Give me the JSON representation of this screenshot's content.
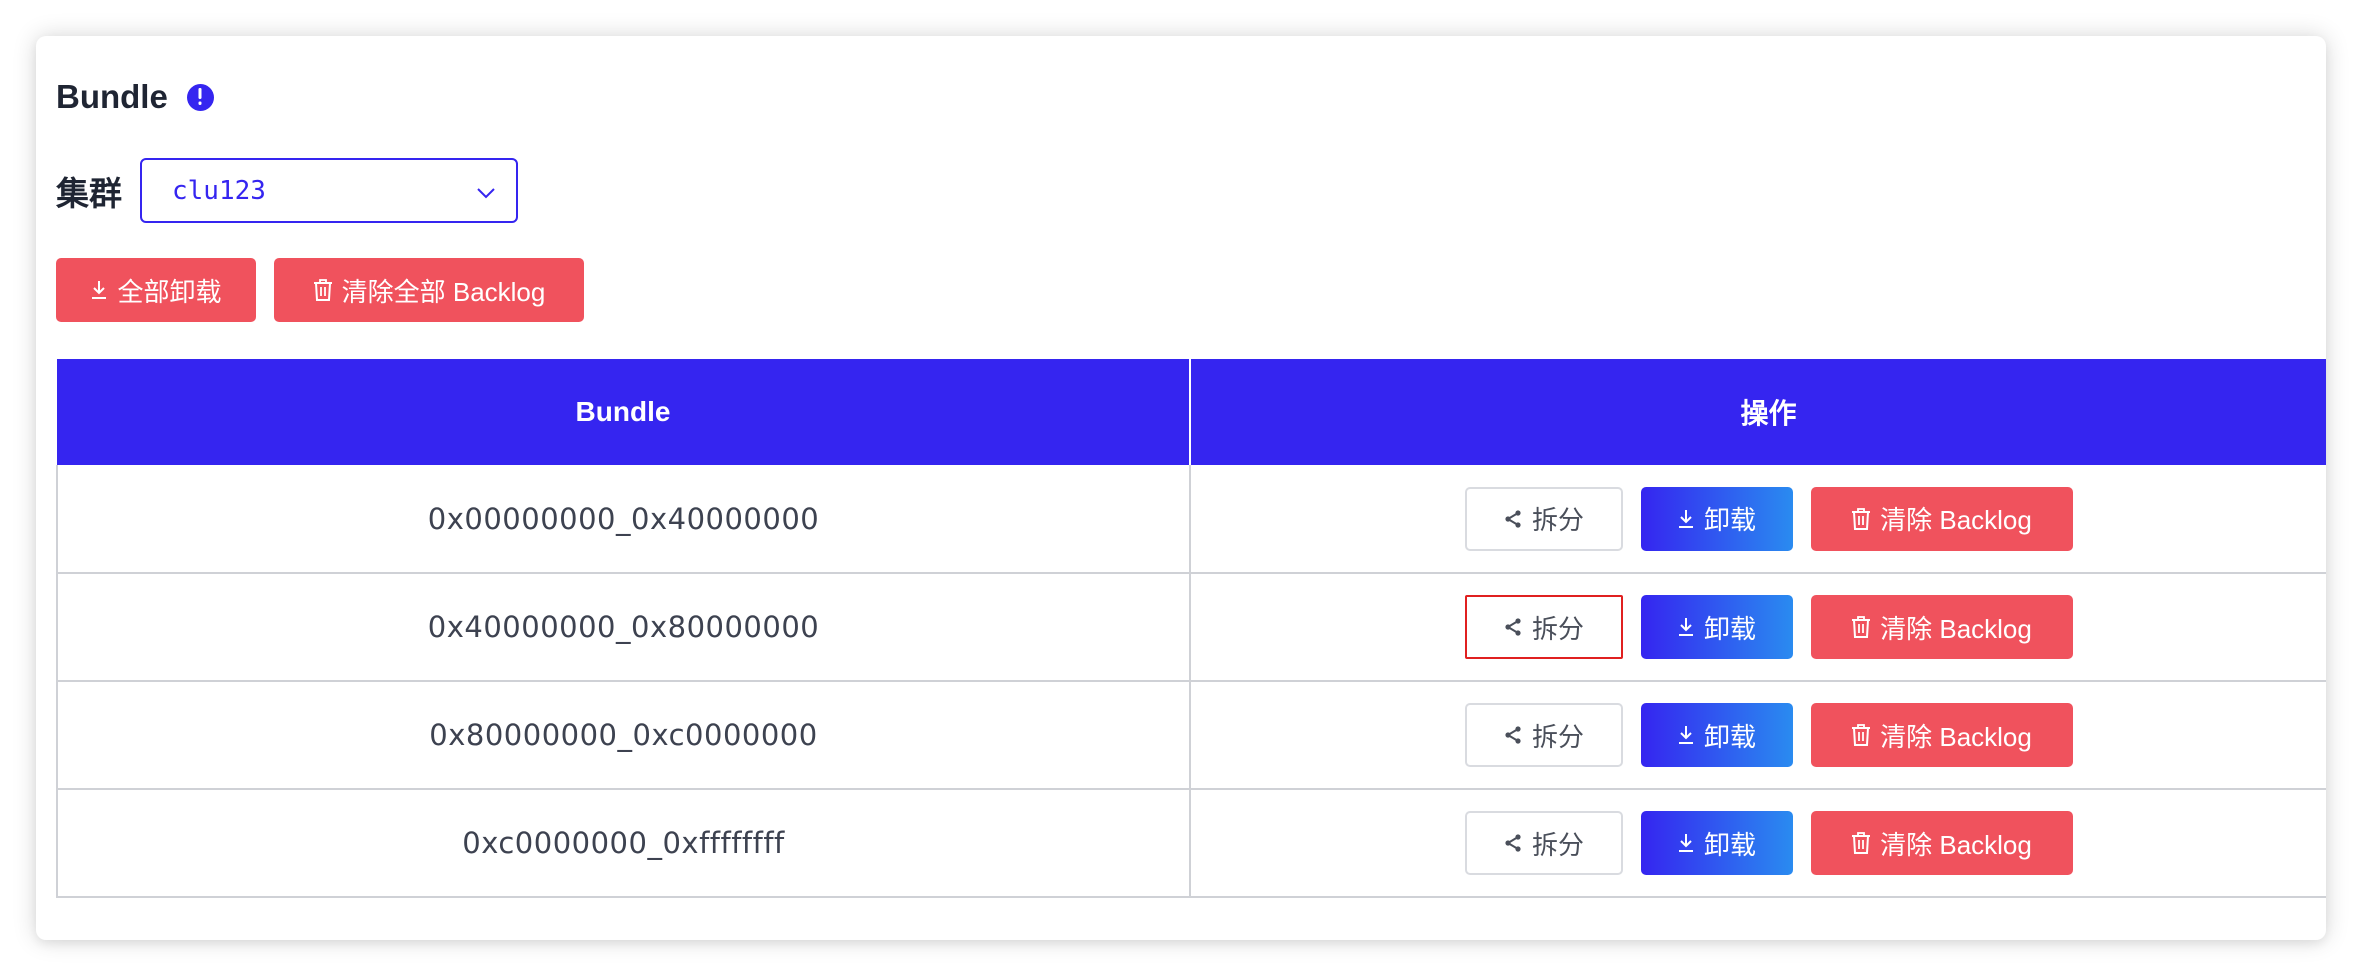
{
  "page": {
    "title": "Bundle",
    "info_icon": "exclamation-circle-icon"
  },
  "cluster": {
    "label": "集群",
    "selected": "clu123"
  },
  "toolbar": {
    "unload_all_label": "全部卸载",
    "clear_all_backlog_label": "清除全部 Backlog"
  },
  "table": {
    "headers": [
      "Bundle",
      "操作"
    ],
    "rows": [
      {
        "bundle": "0x00000000_0x40000000"
      },
      {
        "bundle": "0x40000000_0x80000000"
      },
      {
        "bundle": "0x80000000_0xc0000000"
      },
      {
        "bundle": "0xc0000000_0xffffffff"
      }
    ],
    "actions": {
      "split_label": "拆分",
      "unload_label": "卸载",
      "clear_backlog_label": "清除 Backlog"
    }
  },
  "colors": {
    "primary": "#3525f0",
    "danger": "#f0525d",
    "focus_outline": "#e02020"
  }
}
